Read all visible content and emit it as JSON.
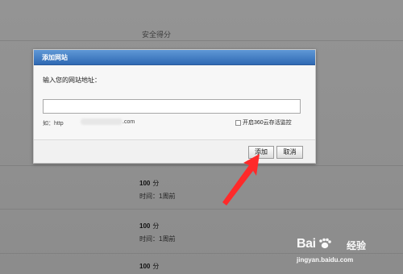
{
  "background": {
    "column_header": "安全得分",
    "rows": [
      {
        "score": "100",
        "unit": "分",
        "time": "时间：1周前"
      },
      {
        "score": "100",
        "unit": "分",
        "time": "时间：1周前"
      },
      {
        "score": "100",
        "unit": "分"
      }
    ]
  },
  "dialog": {
    "title": "添加网站",
    "field_label": "输入您的网站地址：",
    "input_value": "",
    "example_prefix": "如：http",
    "example_suffix": ".com",
    "checkbox_label": "开启360云存活监控",
    "buttons": {
      "add": "添加",
      "cancel": "取消"
    }
  },
  "annotation": {
    "color": "#ff2a2a",
    "icon": "arrow-up-right"
  },
  "watermark": {
    "brand": "Bai",
    "paw_icon": "paw-icon",
    "product": "经验",
    "url": "jingyan.baidu.com"
  }
}
